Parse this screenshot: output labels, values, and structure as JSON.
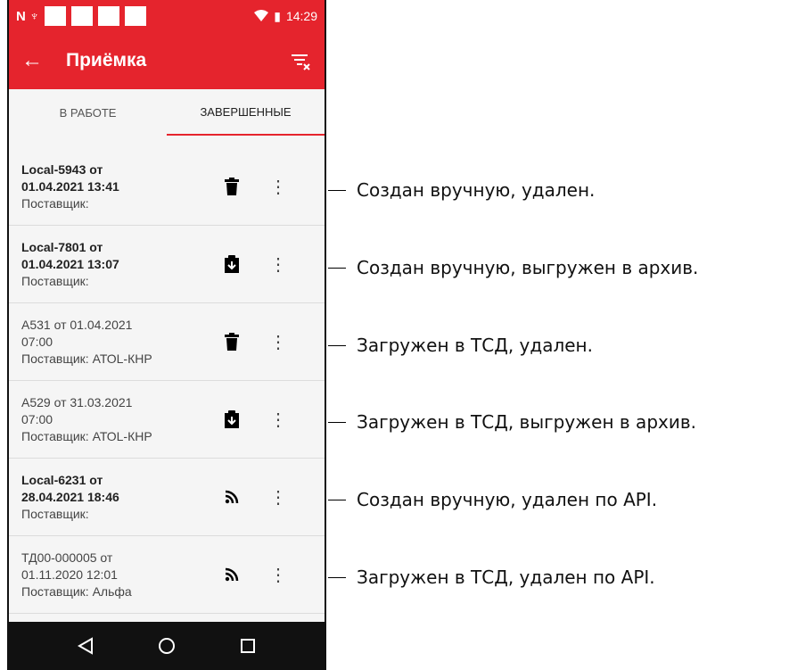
{
  "statusbar": {
    "time": "14:29",
    "left_glyphs": "N  ♆",
    "battery_glyph": "▮"
  },
  "appbar": {
    "title": "Приёмка",
    "back_glyph": "←"
  },
  "tabs": [
    {
      "label": "В РАБОТЕ",
      "active": false
    },
    {
      "label": "ЗАВЕРШЕННЫЕ",
      "active": true
    }
  ],
  "items": [
    {
      "line1": "Local-5943 от",
      "line2": "01.04.2021 13:41",
      "line3": "Поставщик:",
      "bold": true,
      "icon": "trash-icon"
    },
    {
      "line1": "Local-7801 от",
      "line2": "01.04.2021 13:07",
      "line3": "Поставщик:",
      "bold": true,
      "icon": "clipboard-download-icon"
    },
    {
      "line1": "А531 от 01.04.2021",
      "line2": "07:00",
      "line3": "Поставщик: АТОL-КНР",
      "bold": false,
      "icon": "trash-icon"
    },
    {
      "line1": "А529 от 31.03.2021",
      "line2": "07:00",
      "line3": "Поставщик: АТОL-КНР",
      "bold": false,
      "icon": "clipboard-download-icon"
    },
    {
      "line1": "Local-6231 от",
      "line2": "28.04.2021 18:46",
      "line3": "Поставщик:",
      "bold": true,
      "icon": "rss-icon"
    },
    {
      "line1": "ТД00-000005 от",
      "line2": "01.11.2020 12:01",
      "line3": "Поставщик: Альфа",
      "bold": false,
      "icon": "rss-icon"
    }
  ],
  "menu_glyph": "⋮",
  "annotations": [
    "Создан вручную, удален.",
    "Создан вручную, выгружен в архив.",
    "Загружен в ТСД, удален.",
    "Загружен в ТСД, выгружен в архив.",
    "Создан вручную, удален по API.",
    "Загружен в ТСД, удален по API."
  ],
  "colors": {
    "accent": "#e5242d",
    "navbar": "#111111",
    "background": "#f5f5f5"
  }
}
